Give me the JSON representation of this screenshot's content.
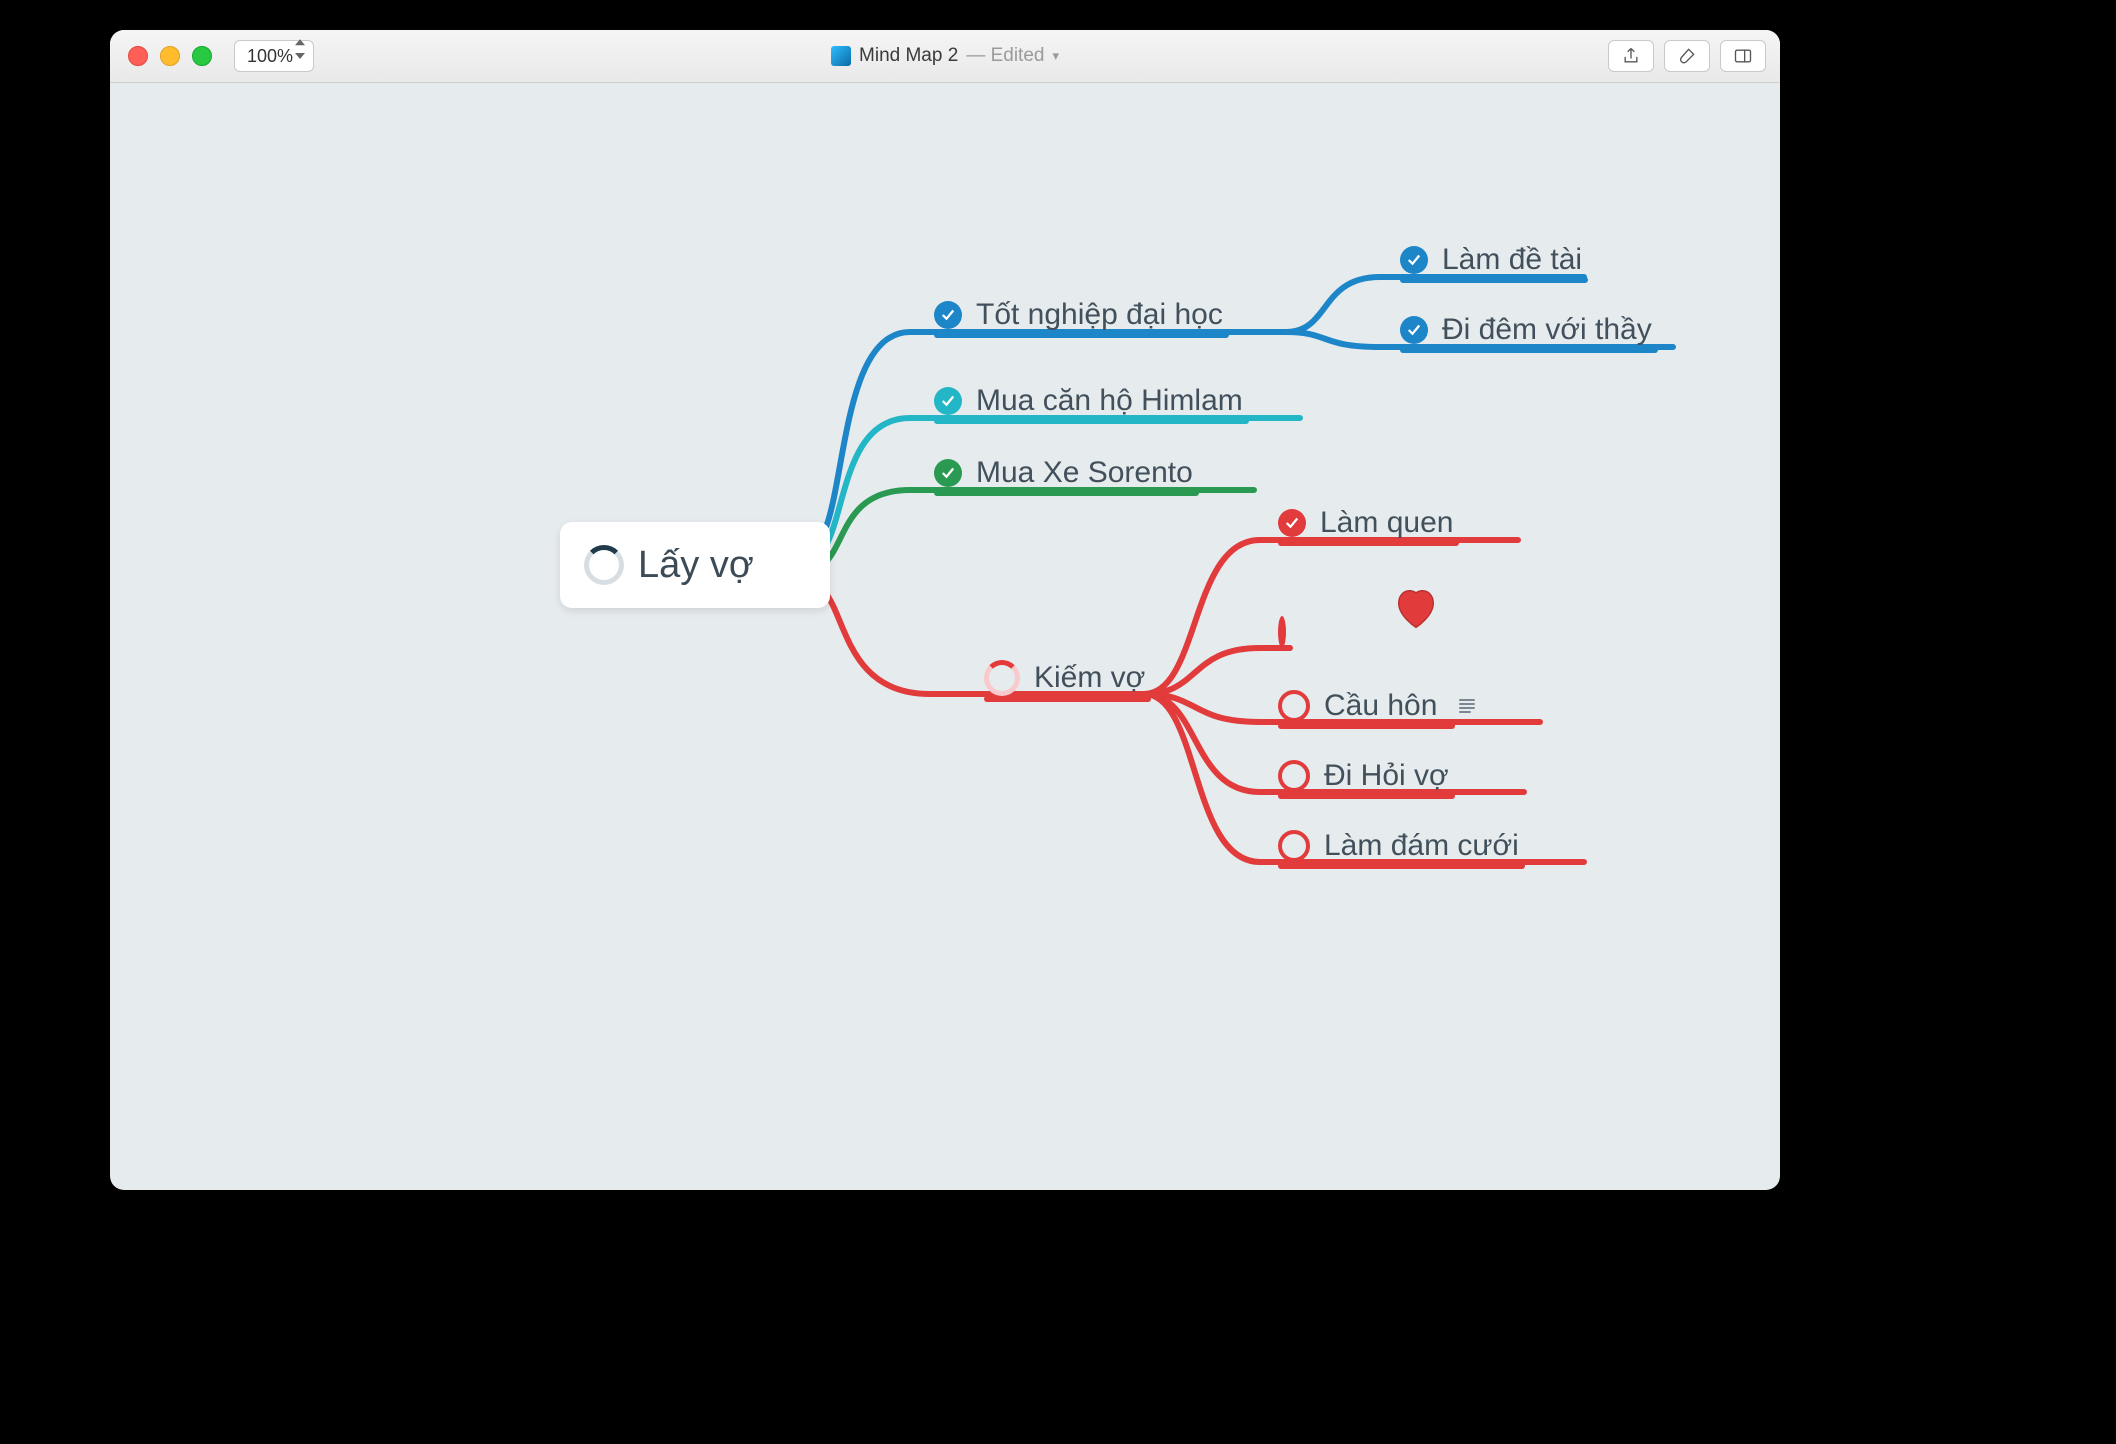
{
  "window": {
    "zoom": "100%",
    "doc_title": "Mind Map 2",
    "edited_suffix": "— Edited"
  },
  "colors": {
    "blue": "#1d86c8",
    "cyan": "#23b6c6",
    "green": "#2a9a52",
    "red": "#e13b3b"
  },
  "mindmap": {
    "root": {
      "label": "Lấy vợ",
      "status": "in-progress"
    },
    "branches": [
      {
        "label": "Tốt nghiệp đại học",
        "color": "blue",
        "status": "done",
        "children": [
          {
            "label": "Làm đề tài",
            "status": "done"
          },
          {
            "label": "Đi đêm với thầy",
            "status": "done"
          }
        ]
      },
      {
        "label": "Mua căn hộ Himlam",
        "color": "cyan",
        "status": "done"
      },
      {
        "label": "Mua Xe Sorento",
        "color": "green",
        "status": "done"
      },
      {
        "label": "Kiếm vợ",
        "color": "red",
        "status": "in-progress",
        "children": [
          {
            "label": "Làm quen",
            "status": "done"
          },
          {
            "label": "",
            "status": "todo",
            "icon": "heart"
          },
          {
            "label": "Cầu hôn",
            "status": "todo",
            "has_note": true
          },
          {
            "label": "Đi Hỏi vợ",
            "status": "todo"
          },
          {
            "label": "Làm đám cưới",
            "status": "todo"
          }
        ]
      }
    ]
  }
}
